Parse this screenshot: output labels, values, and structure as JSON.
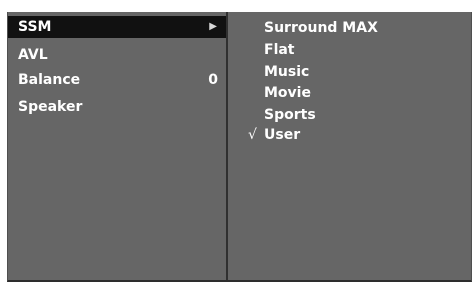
{
  "menu": {
    "items": [
      {
        "label": "SSM",
        "value": "",
        "arrow": "▶"
      },
      {
        "label": "AVL",
        "value": ""
      },
      {
        "label": "Balance",
        "value": "0"
      },
      {
        "label": "Speaker",
        "value": ""
      }
    ],
    "selected_index": 0
  },
  "submenu": {
    "options": [
      {
        "label": "Surround MAX",
        "check": ""
      },
      {
        "label": "Flat",
        "check": ""
      },
      {
        "label": "Music",
        "check": ""
      },
      {
        "label": "Movie",
        "check": ""
      },
      {
        "label": "Sports",
        "check": ""
      },
      {
        "label": "User",
        "check": "√"
      }
    ],
    "checked_option": "User"
  },
  "colors": {
    "panel_background": "#666666",
    "selected_row": "#111111",
    "text": "#ffffff"
  }
}
